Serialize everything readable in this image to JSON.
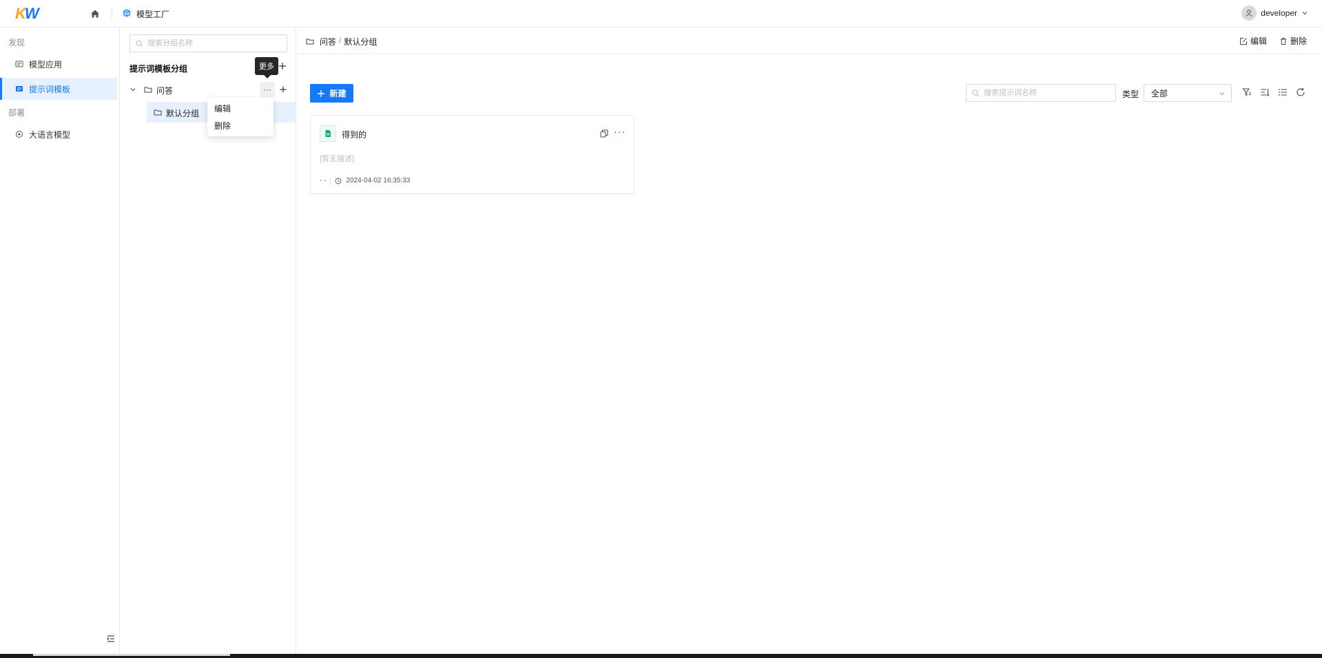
{
  "header": {
    "logo_k": "K",
    "logo_w": "W",
    "app_title": "模型工厂",
    "user_name": "developer"
  },
  "leftnav": {
    "group_discover": "发现",
    "items_discover": [
      {
        "label": "模型应用"
      },
      {
        "label": "提示词模板"
      }
    ],
    "group_deploy": "部署",
    "items_deploy": [
      {
        "label": "大语言模型"
      }
    ]
  },
  "grouppanel": {
    "search_placeholder": "搜索分组名称",
    "title": "提示词模板分组",
    "tree": [
      {
        "label": "问答",
        "children": [
          {
            "label": "默认分组"
          }
        ]
      }
    ],
    "more_button": "···",
    "tooltip": "更多",
    "dropdown": [
      {
        "label": "编辑"
      },
      {
        "label": "删除"
      }
    ]
  },
  "main": {
    "breadcrumb": [
      "问答",
      "/",
      "默认分组"
    ],
    "actions": [
      {
        "label": "编辑"
      },
      {
        "label": "删除"
      }
    ],
    "new_button": "新建",
    "search_placeholder": "搜索提示词名称",
    "type_label": "类型",
    "type_value": "全部",
    "cards": [
      {
        "title": "得到的",
        "description": "[暂无描述]",
        "author": "- -",
        "time": "2024-04-02 16:35:33"
      }
    ]
  },
  "colors": {
    "accent": "#1677ff",
    "selected_bg": "#e6f0ff",
    "tooltip_bg": "#262626"
  }
}
